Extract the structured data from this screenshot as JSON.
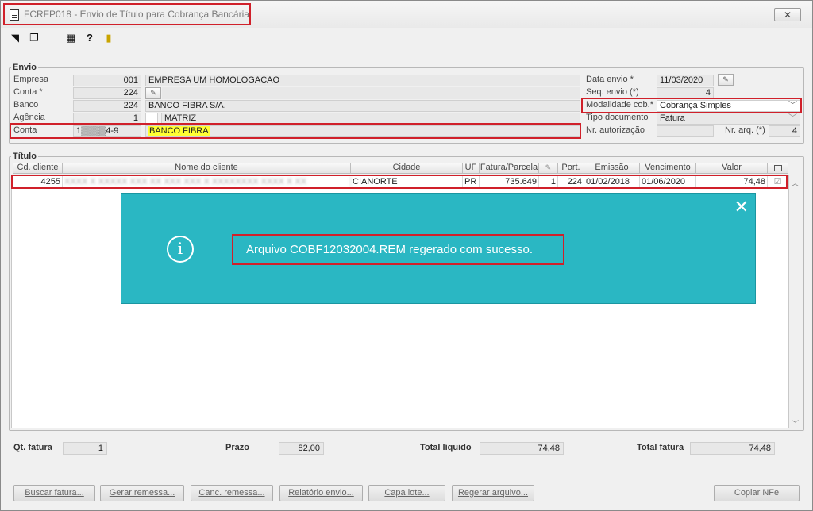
{
  "window": {
    "title": "FCRFP018 - Envio de Título para Cobrança Bancária",
    "close": "✕"
  },
  "toolbar": {
    "icons": [
      "first-record-icon",
      "copy-icon",
      "calendar-icon",
      "help-icon",
      "exit-door-icon"
    ]
  },
  "envio": {
    "legend": "Envio",
    "empresa_label": "Empresa",
    "empresa_code": "001",
    "empresa_name": "EMPRESA UM  HOMOLOGACAO",
    "conta_req_label": "Conta *",
    "conta_req_value": "224",
    "banco_label": "Banco",
    "banco_code": "224",
    "banco_name": "BANCO FIBRA S/A.",
    "agencia_label": "Agência",
    "agencia_code": "1",
    "agencia_name": "MATRIZ",
    "conta_label": "Conta",
    "conta_value": "1▒▒▒▒4-9",
    "conta_name": "BANCO FIBRA",
    "data_envio_label": "Data envio *",
    "data_envio_value": "11/03/2020",
    "seq_envio_label": "Seq. envio (*)",
    "seq_envio_value": "4",
    "modalidade_label": "Modalidade cob.*",
    "modalidade_value": "Cobrança Simples",
    "tipo_doc_label": "Tipo documento",
    "tipo_doc_value": "Fatura",
    "nr_autorizacao_label": "Nr. autorização",
    "nr_autorizacao_value": "",
    "nr_arq_label": "Nr. arq. (*)",
    "nr_arq_value": "4"
  },
  "titulo": {
    "legend": "Título",
    "columns": [
      "Cd. cliente",
      "Nome do cliente",
      "Cidade",
      "UF",
      "Fatura/Parcela",
      "",
      "Port.",
      "Emissão",
      "Vencimento",
      "Valor"
    ],
    "row": {
      "cd_cliente": "4255",
      "nome": "XXXX X XXXXX XXX  XX XXX  XXX X XXXXXXXX XXXX X XX",
      "cidade": "CIANORTE",
      "uf": "PR",
      "fatura": "735.649",
      "parcela": "1",
      "port": "224",
      "emissao": "01/02/2018",
      "vencimento": "01/06/2020",
      "valor": "74,48",
      "checked": true
    }
  },
  "toast": {
    "message": "Arquivo COBF12032004.REM regerado com sucesso.",
    "close": "✕",
    "info": "i"
  },
  "footer": {
    "qt_fatura_label": "Qt. fatura",
    "qt_fatura_value": "1",
    "prazo_label": "Prazo",
    "prazo_value": "82,00",
    "total_liquido_label": "Total líquido",
    "total_liquido_value": "74,48",
    "total_fatura_label": "Total fatura",
    "total_fatura_value": "74,48"
  },
  "buttons": {
    "buscar": "Buscar fatura...",
    "gerar": "Gerar remessa...",
    "canc": "Canc. remessa...",
    "relatorio": "Relatório envio...",
    "capa": "Capa lote...",
    "regerar": "Regerar arquivo...",
    "copiar": "Copiar NFe"
  }
}
